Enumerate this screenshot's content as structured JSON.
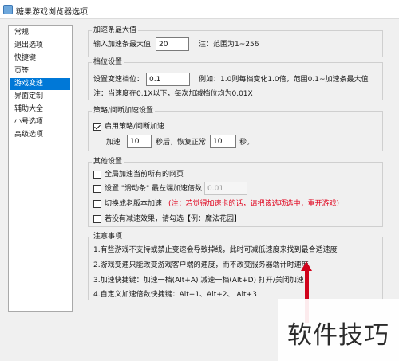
{
  "window": {
    "title": "糖果游戏浏览器选项"
  },
  "sidebar": {
    "items": [
      {
        "label": "常规"
      },
      {
        "label": "退出选项"
      },
      {
        "label": "快捷键"
      },
      {
        "label": "页签"
      },
      {
        "label": "游戏变速",
        "selected": true
      },
      {
        "label": "界面定制"
      },
      {
        "label": "辅助大全"
      },
      {
        "label": "小号选项"
      },
      {
        "label": "高级选项"
      }
    ]
  },
  "accel_max": {
    "legend": "加速条最大值",
    "label": "输入加速条最大值",
    "value": "20",
    "note": "注：范围为1~256"
  },
  "step": {
    "legend": "档位设置",
    "label": "设置变速档位：",
    "value": "0.1",
    "example": "例如：1.0则每档变化1.0倍，范围0.1~加速条最大值",
    "note": "注：当速度在0.1X以下，每次加减档位均为0.01X"
  },
  "strategy": {
    "legend": "策略/间断加速设置",
    "enable_label": "启用策略/间断加速",
    "enable_checked": true,
    "speed_prefix": "加速",
    "speed_value": "10",
    "speed_mid": "秒后，恢复正常",
    "normal_value": "10",
    "speed_suffix": "秒。"
  },
  "other": {
    "legend": "其他设置",
    "global_label": "全局加速当前所有的网页",
    "slider_label": "设置 \"滑动条\" 最左端加速倍数",
    "slider_value": "0.01",
    "old_label": "切换成老版本加速",
    "old_note": "(注：若觉得加速卡的话，请把该选项选中，重开游戏)",
    "noeffect_label": "若没有减速效果，请勾选【例：魔法花园】"
  },
  "notes": {
    "legend": "注意事项",
    "lines": [
      "1.有些游戏不支持或禁止变速会导致掉线，此时可减低速度来找到最合适速度",
      "2.游戏变速只能改变游戏客户端的速度，而不改变服务器端计时速度",
      "3.加速快捷键：加速一档(Alt+A) 减速一档(Alt+D) 打开/关闭加速",
      "4.自定义加速倍数快捷键：Alt+1、Alt+2、 Alt+3"
    ]
  },
  "watermark": {
    "text": "软件技巧"
  }
}
